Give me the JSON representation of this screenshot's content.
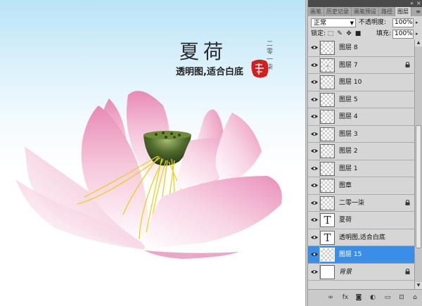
{
  "artwork": {
    "title": "夏荷",
    "subtitle": "透明图,适合白底",
    "vertical_text": "二零一柒",
    "seal_text": "墨韵"
  },
  "panel": {
    "tabs": [
      "画笔",
      "历史记录",
      "画笔预设",
      "路径",
      "图层"
    ],
    "active_tab": "图层",
    "blend_mode": "正常",
    "opacity_label": "不透明度:",
    "opacity_value": "100%",
    "lock_label": "锁定:",
    "fill_label": "填充:",
    "fill_value": "100%",
    "layers": [
      {
        "name": "图层 8",
        "thumb": "transparent",
        "badge": ""
      },
      {
        "name": "图层 7",
        "thumb": "transparent",
        "badge": "lock-icon"
      },
      {
        "name": "图层 10",
        "thumb": "transparent",
        "badge": ""
      },
      {
        "name": "图层 5",
        "thumb": "transparent",
        "badge": ""
      },
      {
        "name": "图层 4",
        "thumb": "transparent",
        "badge": ""
      },
      {
        "name": "图层 3",
        "thumb": "transparent",
        "badge": ""
      },
      {
        "name": "图层 2",
        "thumb": "transparent",
        "badge": ""
      },
      {
        "name": "图层 1",
        "thumb": "transparent",
        "badge": ""
      },
      {
        "name": "图章",
        "thumb": "transparent",
        "badge": ""
      },
      {
        "name": "二零一柒",
        "thumb": "transparent",
        "badge": "lock-icon"
      },
      {
        "name": "夏荷",
        "thumb": "text",
        "thumb_glyph": "T",
        "badge": ""
      },
      {
        "name": "透明图,适合白底",
        "thumb": "text",
        "thumb_glyph": "T",
        "badge": ""
      },
      {
        "name": "图层 15",
        "thumb": "transparent",
        "badge": "",
        "selected": true
      },
      {
        "name": "背景",
        "thumb": "white",
        "badge": "lock-icon",
        "italic": true
      }
    ],
    "bottom_buttons": [
      "link-icon",
      "fx-icon",
      "mask-icon",
      "adjustment-icon",
      "group-icon",
      "new-layer-icon",
      "trash-icon"
    ],
    "bottom_glyphs": [
      "∞",
      "fx",
      "◙",
      "◐",
      "▭",
      "⊡",
      "⌂"
    ],
    "colors": {
      "selected": "#3a8ee6",
      "panel_bg": "#d6d6d6",
      "canvas_top": "#b9e3f6"
    }
  }
}
